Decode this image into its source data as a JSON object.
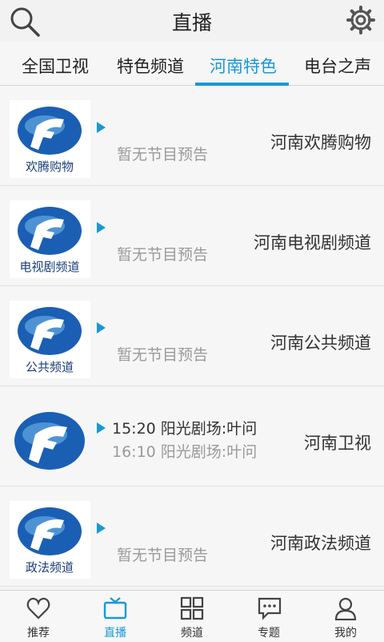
{
  "header": {
    "title": "直播"
  },
  "tabs": [
    {
      "label": "全国卫视"
    },
    {
      "label": "特色频道"
    },
    {
      "label": "河南特色"
    },
    {
      "label": "电台之声"
    }
  ],
  "channels": [
    {
      "name": "河南欢腾购物",
      "logo_text": "欢腾购物",
      "program": "暂无节目预告"
    },
    {
      "name": "河南电视剧频道",
      "logo_text": "电视剧频道",
      "program": "暂无节目预告"
    },
    {
      "name": "河南公共频道",
      "logo_text": "公共频道",
      "program": "暂无节目预告"
    },
    {
      "name": "河南卫视",
      "logo_text": "",
      "now": "15:20 阳光剧场:叶问",
      "next": "16:10 阳光剧场:叶问"
    },
    {
      "name": "河南政法频道",
      "logo_text": "政法频道",
      "program": "暂无节目预告"
    }
  ],
  "bottom_nav": [
    {
      "label": "推荐",
      "icon": "heart-icon"
    },
    {
      "label": "直播",
      "icon": "tv-icon"
    },
    {
      "label": "频道",
      "icon": "grid-icon"
    },
    {
      "label": "专题",
      "icon": "chat-icon"
    },
    {
      "label": "我的",
      "icon": "user-icon"
    }
  ],
  "colors": {
    "accent": "#1998d6",
    "logo_blue": "#1a5fb4"
  }
}
